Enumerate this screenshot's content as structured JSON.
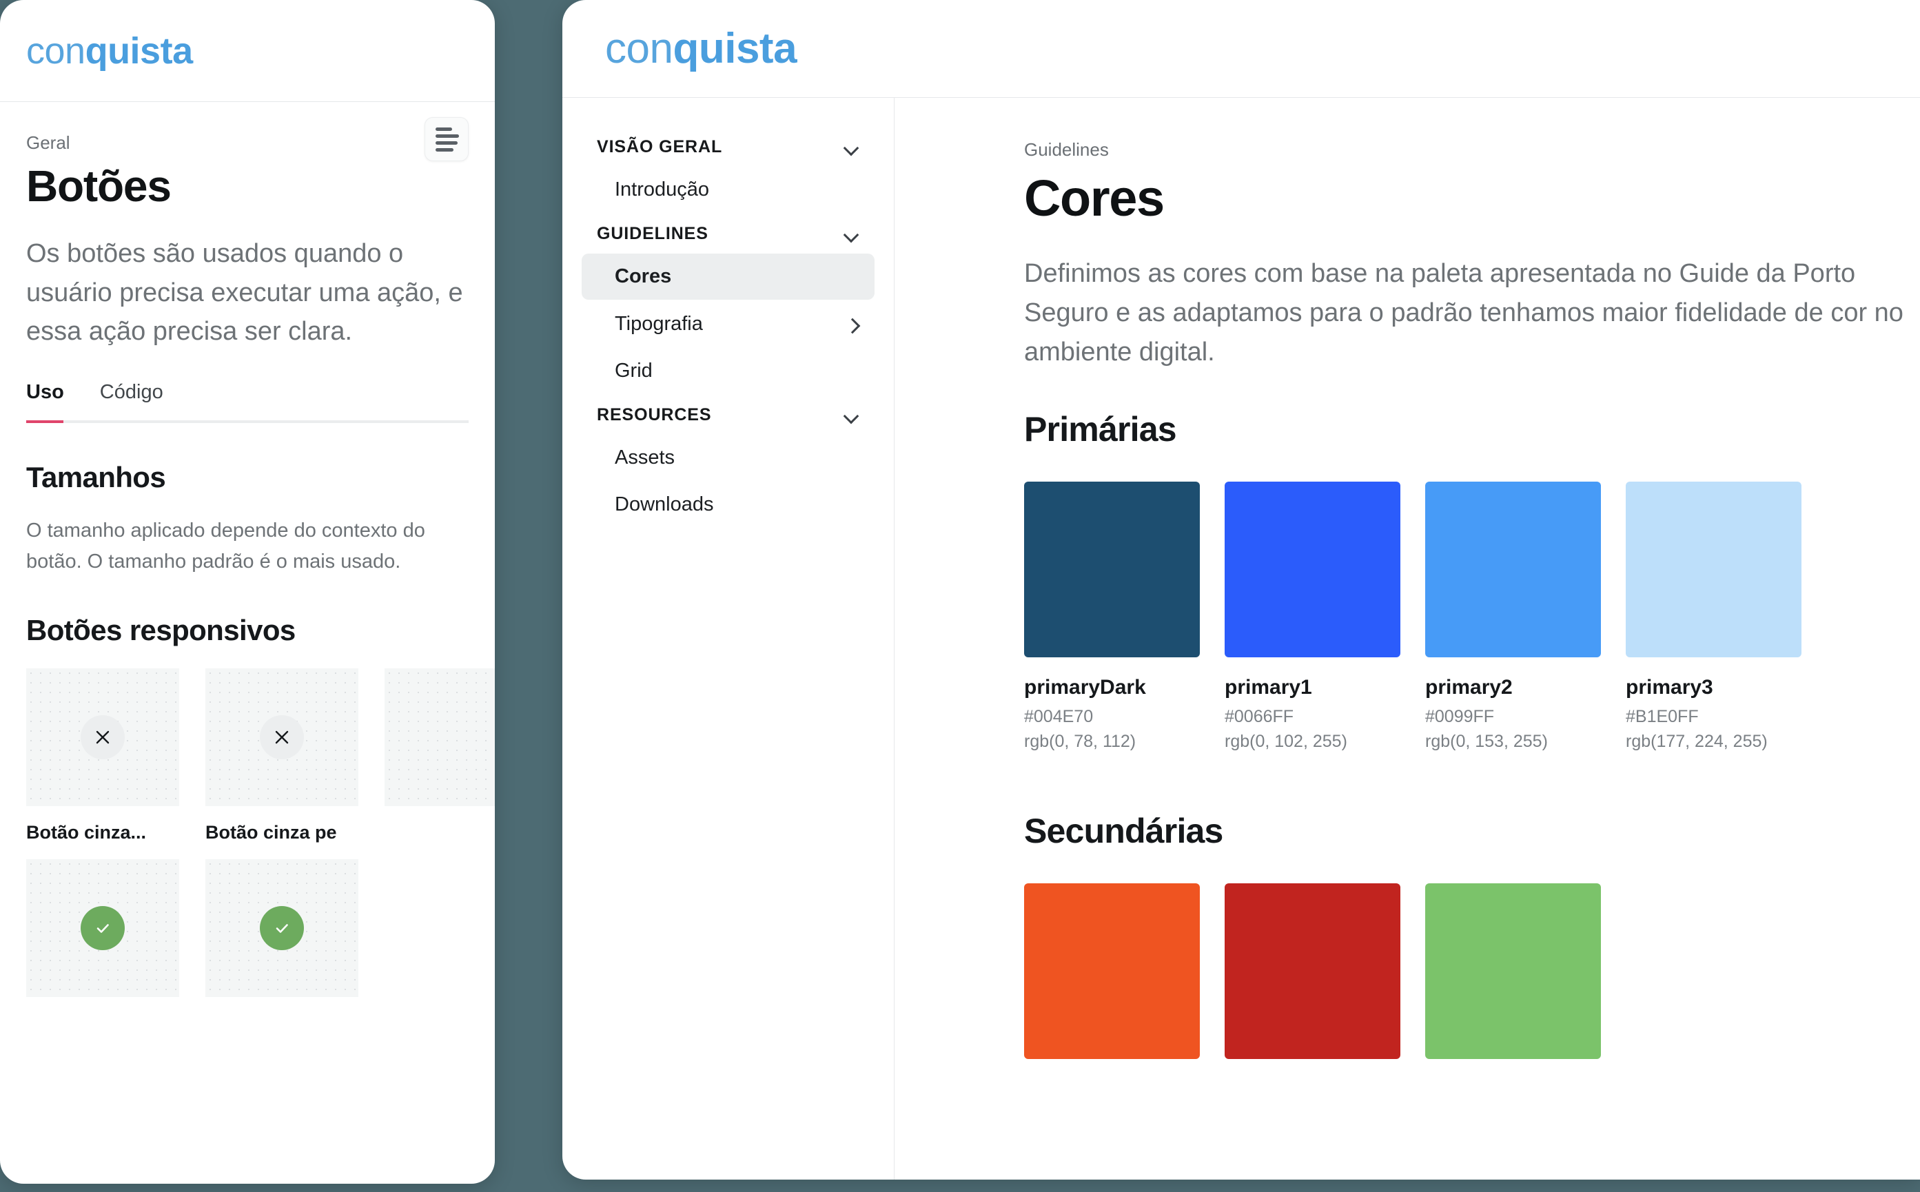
{
  "brand": {
    "logo_light": "con",
    "logo_bold": "quista"
  },
  "mobile": {
    "eyebrow": "Geral",
    "title": "Botões",
    "lede": "Os botões são usados quando o usuário precisa executar uma ação, e essa ação precisa ser clara.",
    "list_button_icon": "align-left-icon",
    "tabs": [
      {
        "label": "Uso",
        "active": true
      },
      {
        "label": "Código",
        "active": false
      }
    ],
    "accent_underline": "#e0456b",
    "sections": [
      {
        "heading": "Tamanhos",
        "body": "O tamanho aplicado depende do contexto do botão. O tamanho padrão é o mais usado."
      },
      {
        "heading": "Botões responsivos"
      }
    ],
    "cards": [
      {
        "label": "Botão cinza...",
        "icon": "close-icon",
        "icon_style": "grey"
      },
      {
        "label": "Botão cinza pe",
        "icon": "close-icon",
        "icon_style": "grey"
      },
      {
        "label": "",
        "icon": "check-icon",
        "icon_style": "green"
      },
      {
        "label": "",
        "icon": "check-icon",
        "icon_style": "green"
      }
    ]
  },
  "desktop": {
    "sidebar": {
      "groups": [
        {
          "label": "VISÃO GERAL",
          "chevron": "chevron-down-icon",
          "items": [
            {
              "label": "Introdução",
              "active": false,
              "chevron": null
            }
          ]
        },
        {
          "label": "GUIDELINES",
          "chevron": "chevron-down-icon",
          "items": [
            {
              "label": "Cores",
              "active": true,
              "chevron": null
            },
            {
              "label": "Tipografia",
              "active": false,
              "chevron": "chevron-right-icon"
            },
            {
              "label": "Grid",
              "active": false,
              "chevron": null
            }
          ]
        },
        {
          "label": "RESOURCES",
          "chevron": "chevron-down-icon",
          "items": [
            {
              "label": "Assets",
              "active": false,
              "chevron": null
            },
            {
              "label": "Downloads",
              "active": false,
              "chevron": null
            }
          ]
        }
      ]
    },
    "content": {
      "eyebrow": "Guidelines",
      "title": "Cores",
      "lede": "Definimos as cores com base na paleta apresentada no Guide da Porto Seguro e as adaptamos para o padrão tenhamos maior fidelidade de cor no ambiente digital.",
      "primary_section": {
        "heading": "Primárias",
        "swatches": [
          {
            "name": "primaryDark",
            "hex": "#004E70",
            "rgb": "rgb(0, 78, 112)",
            "swatch_color": "#1d4e70"
          },
          {
            "name": "primary1",
            "hex": "#0066FF",
            "rgb": "rgb(0, 102, 255)",
            "swatch_color": "#2b5cfb"
          },
          {
            "name": "primary2",
            "hex": "#0099FF",
            "rgb": "rgb(0, 153, 255)",
            "swatch_color": "#479bf7"
          },
          {
            "name": "primary3",
            "hex": "#B1E0FF",
            "rgb": "rgb(177, 224, 255)",
            "swatch_color": "#bddffa"
          }
        ]
      },
      "secondary_section": {
        "heading": "Secundárias",
        "swatches": [
          {
            "name": "",
            "hex": "",
            "rgb": "",
            "swatch_color": "#ef5421"
          },
          {
            "name": "",
            "hex": "",
            "rgb": "",
            "swatch_color": "#c1241f"
          },
          {
            "name": "",
            "hex": "",
            "rgb": "",
            "swatch_color": "#7bc36a"
          }
        ]
      }
    }
  }
}
